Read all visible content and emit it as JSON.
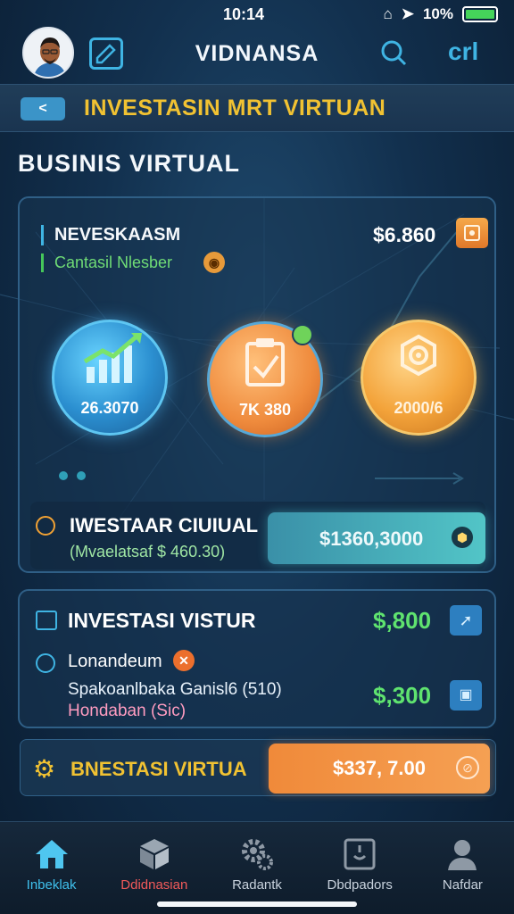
{
  "status_bar": {
    "time": "10:14",
    "battery": "10%",
    "battery_level": 1.0
  },
  "header": {
    "title": "VIDNANSA",
    "ctrl_label": "crl"
  },
  "banner": {
    "back": "<",
    "title": "INVESTASIN MRT VIRTUAN"
  },
  "section": {
    "title": "BUSINIS VIRTUAL"
  },
  "main_card": {
    "title": "NEVESKAASM",
    "amount": "$6.860",
    "subtitle": "Cantasil Nlesber",
    "coins": [
      {
        "value": "26.3070",
        "color": "#2b8fd0",
        "icon": "trending-up-icon"
      },
      {
        "value": "7K 380",
        "color": "#ef8b3d",
        "icon": "document-icon"
      },
      {
        "value": "2000/6",
        "color": "#f3a33a",
        "icon": "gear-badge-icon"
      }
    ],
    "investment_row": {
      "title": "IWESTAAR CIUIUAL",
      "subtitle": "(Mvaelatsaf $ 460.30)",
      "button": "$1360,3000"
    }
  },
  "card2": {
    "title": "INVESTASI VISTUR",
    "amount_1": "$,800",
    "name": "Lonandeum",
    "line_1": "Spakoanlbaka Ganisl6 (510)",
    "line_2": "Hondaban (Sic)",
    "amount_2": "$,300"
  },
  "cta": {
    "title": "BNESTASI VIRTUA",
    "button": "$337, 7.00"
  },
  "tabbar": {
    "items": [
      {
        "label": "Inbeklak",
        "icon": "home-icon"
      },
      {
        "label": "Ddidnasian",
        "icon": "cube-icon"
      },
      {
        "label": "Radantk",
        "icon": "gears-icon"
      },
      {
        "label": "Dbdpadors",
        "icon": "frame-icon"
      },
      {
        "label": "Nafdar",
        "icon": "profile-icon"
      }
    ]
  },
  "colors": {
    "accent": "#3fb4e3",
    "gold": "#f1c232",
    "green": "#5fe36f",
    "orange": "#ef8b3d"
  }
}
